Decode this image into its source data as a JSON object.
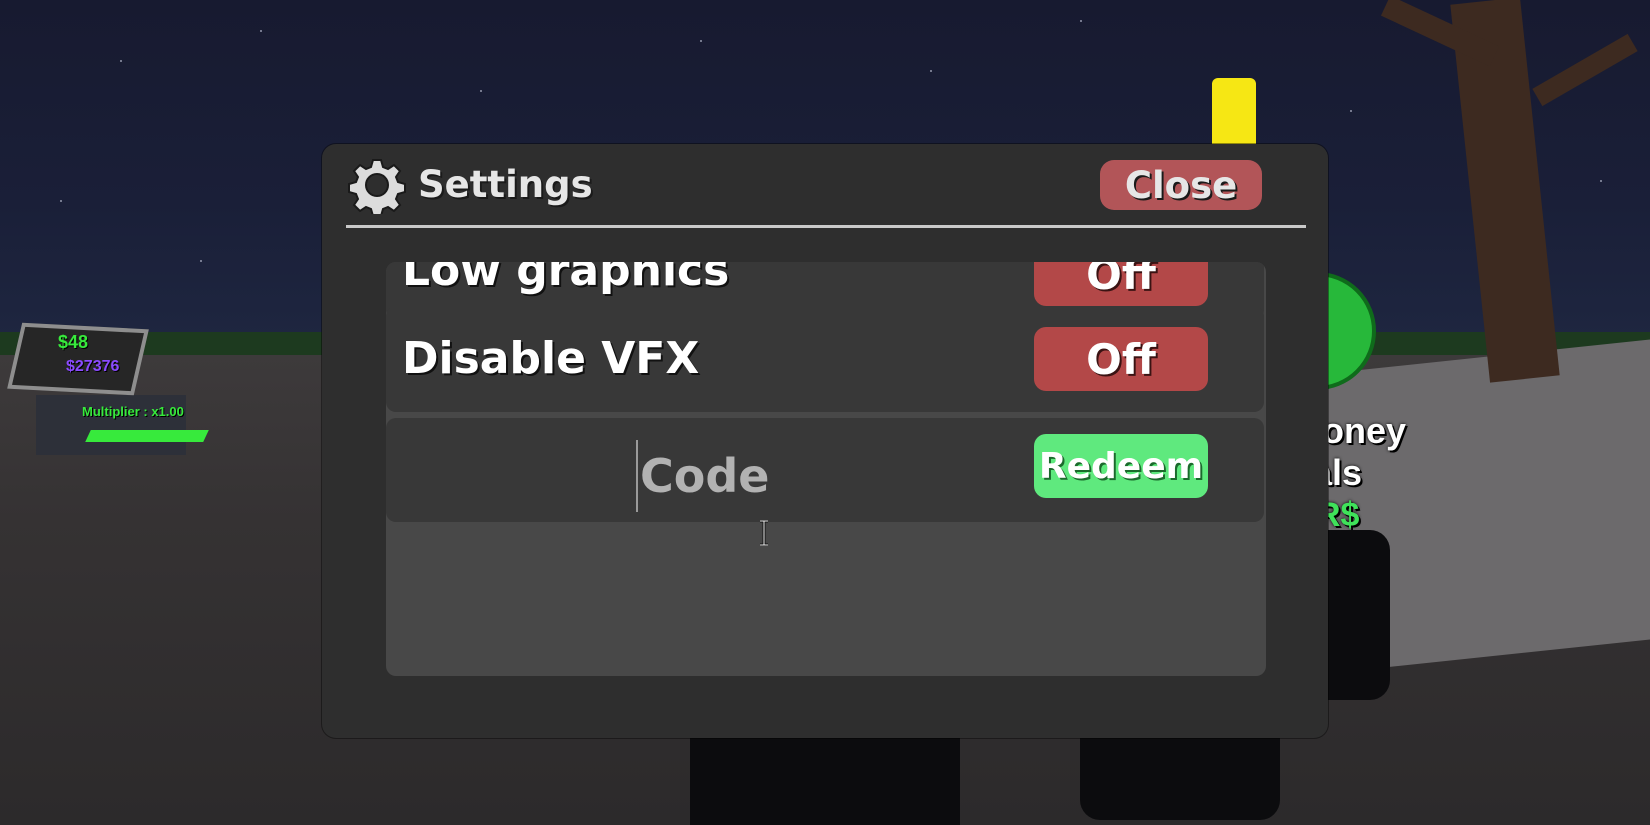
{
  "window": {
    "title": "Settings",
    "close_label": "Close"
  },
  "settings": {
    "rows": [
      {
        "label": "Low graphics",
        "toggle": "Off"
      },
      {
        "label": "Disable VFX",
        "toggle": "Off"
      }
    ],
    "code_placeholder": "Code",
    "redeem_label": "Redeem"
  },
  "world": {
    "kiosk_cash": "$48",
    "kiosk_value": "$27376",
    "kiosk_multiplier": "Multiplier : x1.00",
    "sign_line1": "loney",
    "sign_line2": "als",
    "sign_line3": "R$"
  },
  "colors": {
    "panel": "#2e2e2e",
    "close_button": "#b25558",
    "toggle_off": "#b34848",
    "redeem": "#5fe97e"
  }
}
